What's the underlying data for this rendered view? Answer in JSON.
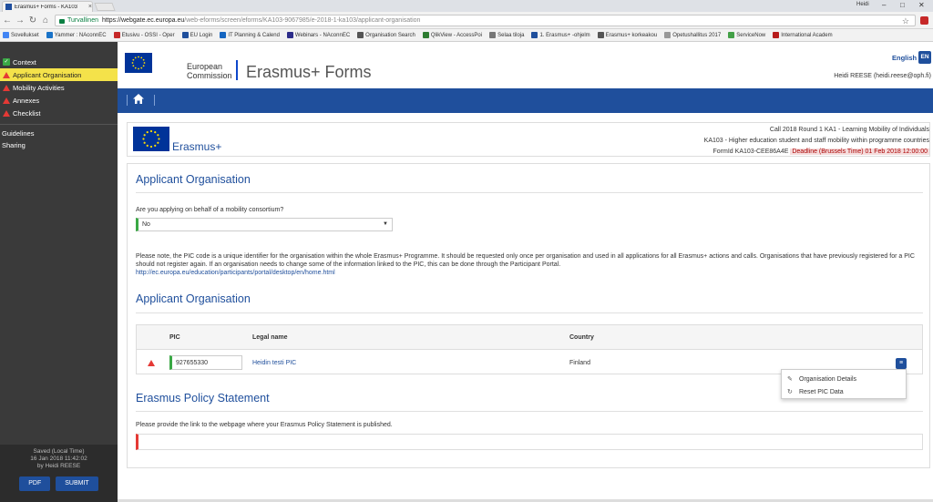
{
  "browser": {
    "tab_title": "Erasmus+ Forms - KA103",
    "tab_close": "×",
    "window_user": "Heidi",
    "secure_label": "Turvallinen",
    "url_host": "https://webgate.ec.europa.eu",
    "url_path": "/web-eforms/screen/eforms/KA103-9067985/e-2018-1-ka103/applicant-organisation",
    "bookmarks": [
      "Sovellukset",
      "Yammer : NAconnEC",
      "Etusivu - OSSI - Oper",
      "EU Login",
      "IT Planning & Calend",
      "Webinars - NAconnEC",
      "Organisation Search",
      "QlikView - AccessPoi",
      "Selaa tiloja",
      "1. Erasmus+ -ohjelm",
      "Erasmus+ korkeakou",
      "Opetushallitus 2017",
      "ServiceNow",
      "International Academ"
    ]
  },
  "sidebar": {
    "items": [
      {
        "label": "Context",
        "status": "ok"
      },
      {
        "label": "Applicant Organisation",
        "status": "warn"
      },
      {
        "label": "Mobility Activities",
        "status": "warn"
      },
      {
        "label": "Annexes",
        "status": "warn"
      },
      {
        "label": "Checklist",
        "status": "warn"
      }
    ],
    "links": [
      "Guidelines",
      "Sharing"
    ],
    "saved_label": "Saved (Local Time)",
    "saved_time": "16 Jan 2018 11:42:02",
    "saved_by": "by Heidi REESE",
    "pdf_button": "PDF",
    "submit_button": "SUBMIT"
  },
  "header": {
    "ec_line1": "European",
    "ec_line2": "Commission",
    "brand": "Erasmus+ Forms",
    "language": "English",
    "language_code": "EN",
    "user": "Heidi REESE (heidi.reese@oph.fi)"
  },
  "form_card": {
    "logo_text": "Erasmus+",
    "call_line": "Call 2018  Round 1  KA1 - Learning Mobility of Individuals",
    "action_line": "KA103 - Higher education student and staff mobility within programme countries",
    "formid": "FormId KA103-CEE86A4E",
    "deadline": "Deadline (Brussels Time) 01 Feb 2018 12:00:00"
  },
  "main": {
    "section1_title": "Applicant Organisation",
    "consortium_question": "Are you applying on behalf of a mobility consortium?",
    "consortium_value": "No",
    "note_text": "Please note, the PIC code is a unique identifier for the organisation within the whole Erasmus+ Programme. It should be requested only once per organisation and used in all applications for all Erasmus+ actions and calls. Organisations that have previously registered for a PIC should not register again. If an organisation needs to change some of the information linked to the PIC, this can be done through the Participant Portal.",
    "note_link": "http://ec.europa.eu/education/participants/portal/desktop/en/home.html",
    "section2_title": "Applicant Organisation",
    "table": {
      "columns": [
        "PIC",
        "Legal name",
        "Country"
      ],
      "row": {
        "pic": "927655330",
        "legal_name": "Heidin testi PIC",
        "country": "Finland"
      }
    },
    "dropdown_items": [
      "Organisation Details",
      "Reset PIC Data"
    ],
    "section3_title": "Erasmus Policy Statement",
    "eps_question": "Please provide the link to the webpage where your Erasmus Policy Statement is published."
  },
  "colors": {
    "eu_blue": "#1f4f9c",
    "warn_red": "#e53935",
    "ok_green": "#3aa845",
    "active_yellow": "#f4e24a"
  }
}
